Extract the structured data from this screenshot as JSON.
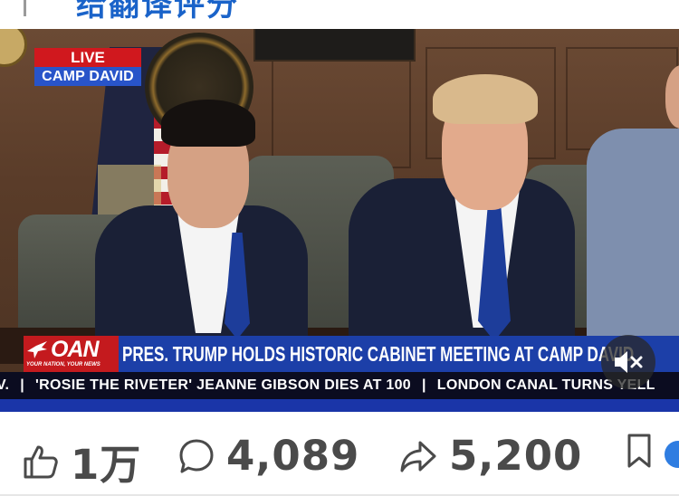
{
  "page": {
    "top_title": "给翻译评分"
  },
  "video": {
    "live_label": "LIVE",
    "location_label": "CAMP DAVID",
    "network": {
      "logo": "OAN",
      "tagline": "YOUR NATION, YOUR NEWS"
    },
    "headline": "PRES. TRUMP HOLDS HISTORIC CABINET MEETING AT CAMP DAVID",
    "ticker_items": [
      "V.",
      "'ROSIE THE RIVETER' JEANNE GIBSON DIES AT 100",
      "LONDON CANAL TURNS YELL"
    ],
    "ticker_separator": "|",
    "mute_icon": "speaker-muted-icon",
    "colors": {
      "live_red": "#d0181e",
      "location_blue": "#2854c9",
      "headline_blue": "#1c3fa8",
      "oan_red": "#c41a1e",
      "ticker_dark": "#0b0c20"
    }
  },
  "actions": {
    "like": {
      "icon": "thumbs-up-icon",
      "count": "1万"
    },
    "comment": {
      "icon": "comment-bubble-icon",
      "count": "4,089"
    },
    "share": {
      "icon": "share-arrow-icon",
      "count": "5,200"
    },
    "bookmark": {
      "icon": "bookmark-icon"
    }
  }
}
